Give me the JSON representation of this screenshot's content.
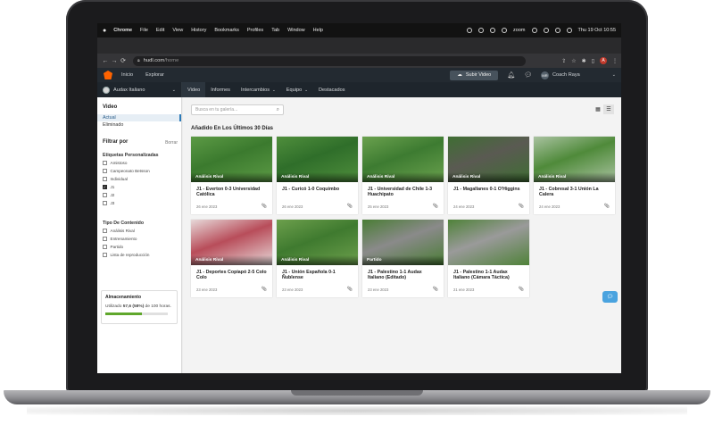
{
  "menubar": {
    "apple": "",
    "items": [
      "Chrome",
      "File",
      "Edit",
      "View",
      "History",
      "Bookmarks",
      "Profiles",
      "Tab",
      "Window",
      "Help"
    ],
    "zoom": "zoom",
    "clock": "Thu 19 Oct  10:55"
  },
  "browser": {
    "back": "←",
    "forward": "→",
    "reload": "⟳",
    "url_host": "hudl.com",
    "url_path": "/home",
    "profile_initial": "A"
  },
  "hudl_nav": {
    "links": [
      "Inicio",
      "Explorar"
    ],
    "upload_label": "Subir Video",
    "user_initials": "MR",
    "user_name": "Coach Raya"
  },
  "team_bar": {
    "team_name": "Audax Italiano",
    "tabs": [
      {
        "label": "Video",
        "active": true,
        "dropdown": false
      },
      {
        "label": "Informes",
        "active": false,
        "dropdown": false
      },
      {
        "label": "Intercambios",
        "active": false,
        "dropdown": true
      },
      {
        "label": "Equipo",
        "active": false,
        "dropdown": true
      },
      {
        "label": "Destacados",
        "active": false,
        "dropdown": false
      }
    ]
  },
  "sidebar": {
    "video_title": "Video",
    "items": [
      {
        "label": "Actual",
        "active": true
      },
      {
        "label": "Eliminado",
        "active": false
      }
    ],
    "filter_title": "Filtrar por",
    "clear_label": "Borrar",
    "labels_title": "Etiquetas Personalizadas",
    "labels": [
      {
        "label": "Amistoso",
        "checked": false
      },
      {
        "label": "Campeonato Betsson",
        "checked": false
      },
      {
        "label": "Individual",
        "checked": false
      },
      {
        "label": "J1",
        "checked": true
      },
      {
        "label": "J2",
        "checked": false
      },
      {
        "label": "J3",
        "checked": false
      }
    ],
    "content_title": "Tipo De Contenido",
    "content_types": [
      {
        "label": "Análisis Rival",
        "checked": false
      },
      {
        "label": "Entrenamiento",
        "checked": false
      },
      {
        "label": "Partido",
        "checked": false
      },
      {
        "label": "Lista de reproducción",
        "checked": false
      }
    ],
    "storage": {
      "title": "Almacenamiento",
      "text_prefix": "Utilizado ",
      "used": "57,6 (58%)",
      "text_suffix": " de 100 horas.",
      "fraction_used": 0.58
    }
  },
  "main": {
    "search_placeholder": "Busca en tu galería...",
    "section_title": "Añadido En Los Últimos 30 Días",
    "videos": [
      {
        "tag": "Análisis Rival",
        "title": "J1 - Everton 0-3 Universidad Católica",
        "date": "26 ene 2023"
      },
      {
        "tag": "Análisis Rival",
        "title": "J1 - Curicó 1-0 Coquimbo",
        "date": "26 ene 2023"
      },
      {
        "tag": "Análisis Rival",
        "title": "J1 - Universidad de Chile 1-3 Huachipato",
        "date": "25 ene 2023"
      },
      {
        "tag": "Análisis Rival",
        "title": "J1 - Magallanes 0-1 O'Higgins",
        "date": "24 ene 2023"
      },
      {
        "tag": "Análisis Rival",
        "title": "J1 - Cobresal 3-1 Unión La Calera",
        "date": "24 ene 2023"
      },
      {
        "tag": "Análisis Rival",
        "title": "J1 - Deportes Copiapó 2-5 Colo Colo",
        "date": "23 ene 2023"
      },
      {
        "tag": "Análisis Rival",
        "title": "J1 - Unión Española 0-1 Ñublense",
        "date": "23 ene 2023"
      },
      {
        "tag": "Partido",
        "title": "J1 - Palestino 1-1 Audax Italiano (Editado)",
        "date": "23 ene 2023"
      },
      {
        "tag": "",
        "title": "J1 - Palestino 1-1 Audax Italiano (Cámara Táctica)",
        "date": "21 ene 2023"
      }
    ]
  },
  "icons": {
    "search": "search-icon",
    "grid_view": "grid-icon",
    "list_view": "list-icon",
    "clip": "clip-icon",
    "bell": "bell-icon",
    "messages": "messages-icon",
    "chat_fab": "chat-icon"
  },
  "colors": {
    "hudl_orange": "#ff6300",
    "nav_bg": "#232a31",
    "active_link": "#2c7ab8",
    "storage_bar": "#5fa72b",
    "fab": "#4aa3df"
  }
}
